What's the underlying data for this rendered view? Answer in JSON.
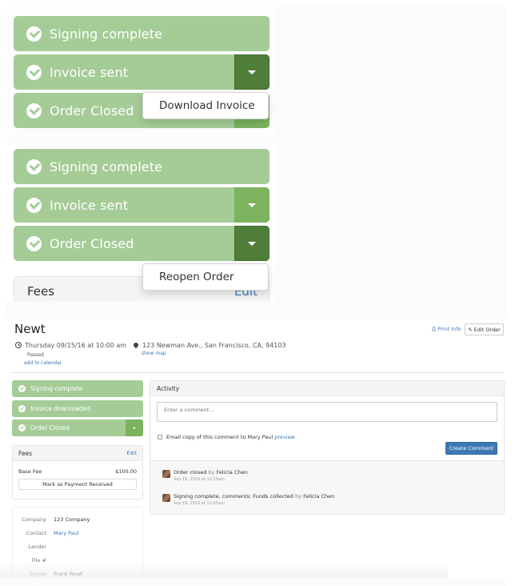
{
  "panel_a": {
    "bars": [
      {
        "label": "Signing complete",
        "has_caret": false
      },
      {
        "label": "Invoice sent",
        "has_caret": true,
        "caret_state": "active"
      },
      {
        "label": "Order Closed",
        "has_caret": true,
        "caret_state": "hidden-behind-menu"
      }
    ],
    "menu": {
      "items": [
        "Download Invoice"
      ]
    }
  },
  "panel_b": {
    "bars": [
      {
        "label": "Signing complete",
        "has_caret": false
      },
      {
        "label": "Invoice sent",
        "has_caret": true,
        "caret_state": "normal"
      },
      {
        "label": "Order Closed",
        "has_caret": true,
        "caret_state": "active"
      }
    ],
    "menu": {
      "items": [
        "Reopen Order"
      ]
    },
    "fees_peek": {
      "title": "Fees",
      "edit": "Edit"
    }
  },
  "order": {
    "title": "Newt",
    "datetime": "Thursday 09/15/16 at 10:00 am",
    "status": "Passed",
    "add_to_calendar": "add to calendar",
    "address": "123 Newman Ave., San Francisco, CA, 94103",
    "show_map": "show map",
    "print_info": "Print Info",
    "edit_order": "Edit Order"
  },
  "status_bars": [
    {
      "label": "Signing complete",
      "has_caret": false
    },
    {
      "label": "Invoice downloaded",
      "has_caret": false
    },
    {
      "label": "Order Closed",
      "has_caret": true
    }
  ],
  "fees": {
    "title": "Fees",
    "edit": "Edit",
    "rows": [
      {
        "label": "Base Fee",
        "value": "$100.00"
      }
    ],
    "mark_paid": "Mark as Payment Received"
  },
  "details": [
    {
      "label": "Company",
      "value": "123 Company",
      "link": false
    },
    {
      "label": "Contact",
      "value": "Mary Paul",
      "link": true
    },
    {
      "label": "Lender",
      "value": "",
      "link": false
    },
    {
      "label": "File #",
      "value": "",
      "link": false
    },
    {
      "label": "Signer",
      "value": "Frank Newt",
      "link": false
    }
  ],
  "activity": {
    "title": "Activity",
    "comment_placeholder": "Enter a comment...",
    "email_copy_label": "Email copy of this comment to Mary Paul",
    "preview": "preview",
    "create_comment": "Create Comment",
    "items": [
      {
        "text": "Order closed",
        "by": "by",
        "author": "Felicia Chen",
        "time": "Sep 16, 2016 at 11:15am"
      },
      {
        "text": "Signing complete, comments: Funds collected",
        "by": "by",
        "author": "Felicia Chen",
        "time": "Sep 16, 2016 at 11:05am"
      }
    ]
  },
  "colors": {
    "bar_green": "#a5cc97",
    "caret_dark": "#4f7e39",
    "caret_mid": "#7bb35f",
    "link_blue": "#3a78b5",
    "primary_button": "#3d78b5"
  }
}
